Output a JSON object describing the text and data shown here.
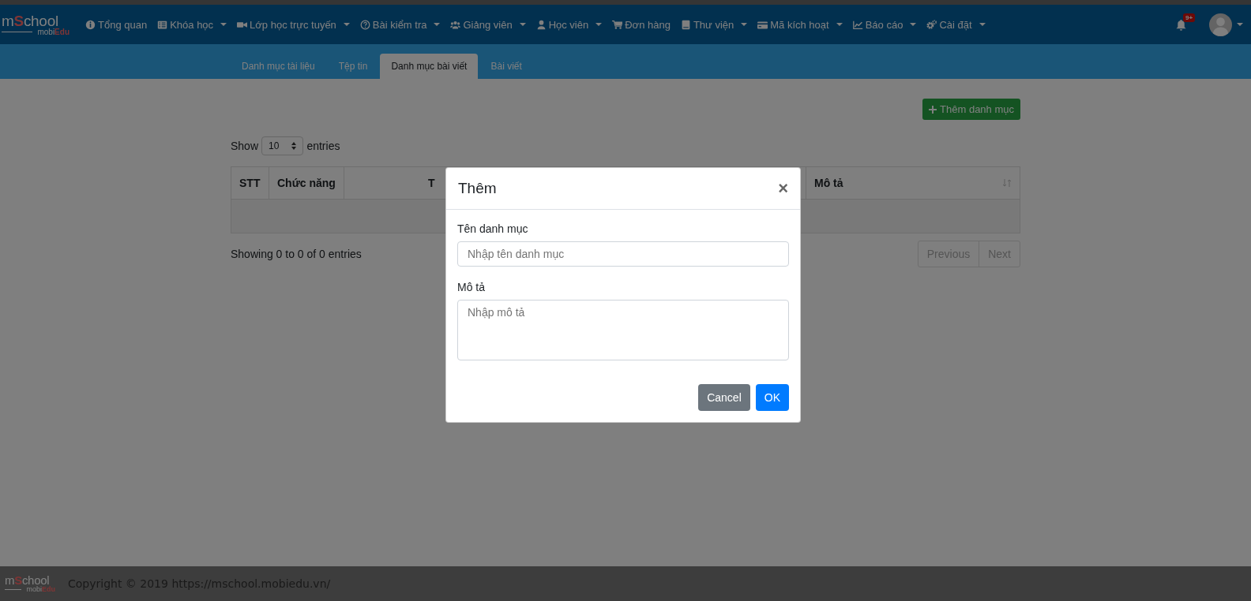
{
  "logo": {
    "name": [
      {
        "text": "m",
        "accent": false
      },
      {
        "text": "S",
        "accent": true
      },
      {
        "text": "chool",
        "accent": false
      }
    ],
    "tagline": [
      {
        "text": "mobi",
        "accent": false
      },
      {
        "text": "Edu",
        "accent": true
      }
    ]
  },
  "nav": [
    {
      "label": "Tổng quan",
      "dropdown": false
    },
    {
      "label": "Khóa học",
      "dropdown": true
    },
    {
      "label": "Lớp học trực tuyến",
      "dropdown": true
    },
    {
      "label": "Bài kiểm tra",
      "dropdown": true
    },
    {
      "label": "Giảng viên",
      "dropdown": true
    },
    {
      "label": "Học viên",
      "dropdown": true
    },
    {
      "label": "Đơn hàng",
      "dropdown": false
    },
    {
      "label": "Thư viện",
      "dropdown": true
    },
    {
      "label": "Mã kích hoạt",
      "dropdown": true
    },
    {
      "label": "Báo cáo",
      "dropdown": true
    },
    {
      "label": "Cài đặt",
      "dropdown": true
    }
  ],
  "notifications": {
    "badge": "9+"
  },
  "tabs": [
    {
      "label": "Danh mục tài liệu",
      "selected": false
    },
    {
      "label": "Tệp tin",
      "selected": false
    },
    {
      "label": "Danh mục bài viết",
      "selected": true
    },
    {
      "label": "Bài viết",
      "selected": false
    }
  ],
  "add_button": "Thêm danh mục",
  "length": {
    "before": "Show",
    "value": "10",
    "after": "entries"
  },
  "table": {
    "columns": [
      {
        "label": "STT",
        "sortable": false
      },
      {
        "label": "Chức năng",
        "sortable": false
      },
      {
        "label": "T",
        "sortable": false
      },
      {
        "label": "Mô tả",
        "sortable": true
      }
    ]
  },
  "info": "Showing 0 to 0 of 0 entries",
  "pagination": [
    {
      "label": "Previous",
      "disabled": true
    },
    {
      "label": "Next",
      "disabled": true
    }
  ],
  "modal": {
    "title": "Thêm",
    "close": "×",
    "fields": [
      {
        "kind": "input",
        "label": "Tên danh mục",
        "placeholder": "Nhập tên danh mục"
      },
      {
        "kind": "textarea",
        "label": "Mô tả",
        "placeholder": "Nhập mô tả"
      }
    ],
    "buttons": [
      {
        "kind": "secondary",
        "label": "Cancel"
      },
      {
        "kind": "primary",
        "label": "OK"
      }
    ]
  },
  "footer": {
    "logo": {
      "name": [
        {
          "text": "m",
          "accent": false
        },
        {
          "text": "S",
          "accent": true
        },
        {
          "text": "chool",
          "accent": false
        }
      ],
      "tagline": [
        {
          "text": "mobi",
          "accent": false
        },
        {
          "text": "Edu",
          "accent": true
        }
      ]
    },
    "copyright": "Copyright © 2019 https://mschool.mobiedu.vn/"
  }
}
